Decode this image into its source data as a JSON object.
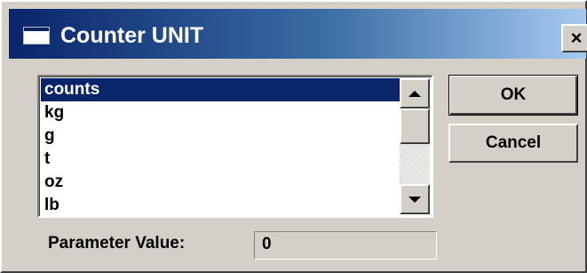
{
  "window": {
    "title": "Counter UNIT",
    "close_label": "×"
  },
  "unit_list": {
    "items": [
      "counts",
      "kg",
      "g",
      "t",
      "oz",
      "lb"
    ],
    "selected_index": 0
  },
  "buttons": {
    "ok_label": "OK",
    "cancel_label": "Cancel"
  },
  "parameter": {
    "label": "Parameter Value:",
    "value": "0"
  },
  "colors": {
    "title_gradient_start": "#0a246a",
    "title_gradient_end": "#a6caf0",
    "selection_background": "#0a246a",
    "dialog_background": "#d4d0c8"
  }
}
